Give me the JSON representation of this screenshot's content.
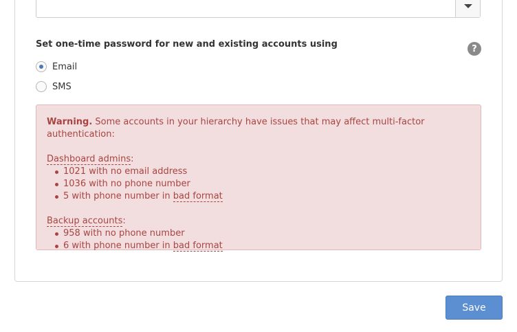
{
  "form": {
    "select": {
      "arrow_icon": "chevron-down-icon"
    },
    "otp_heading": "Set one-time password for new and existing accounts using",
    "help_icon": "?",
    "radios": [
      {
        "label": "Email",
        "checked": true
      },
      {
        "label": "SMS",
        "checked": false
      }
    ]
  },
  "warning": {
    "lead": "Warning.",
    "message": " Some accounts in your hierarchy have issues that may affect multi-factor authentication:",
    "dashboard_title": "Dashboard admins",
    "dashboard_items": [
      {
        "text": "1021 with no email address",
        "link": ""
      },
      {
        "text": "1036 with no phone number",
        "link": ""
      },
      {
        "text": "5 with phone number in ",
        "link": "bad format"
      }
    ],
    "backup_title": "Backup accounts",
    "backup_items": [
      {
        "text": "958 with no phone number",
        "link": ""
      },
      {
        "text": "6 with phone number in ",
        "link": "bad format"
      }
    ],
    "colon": ":"
  },
  "actions": {
    "save_label": "Save"
  },
  "colors": {
    "warning_bg": "#f2dede",
    "warning_text": "#a94442",
    "primary_button": "#5b8fd1",
    "radio_selected": "#4a78b8"
  }
}
